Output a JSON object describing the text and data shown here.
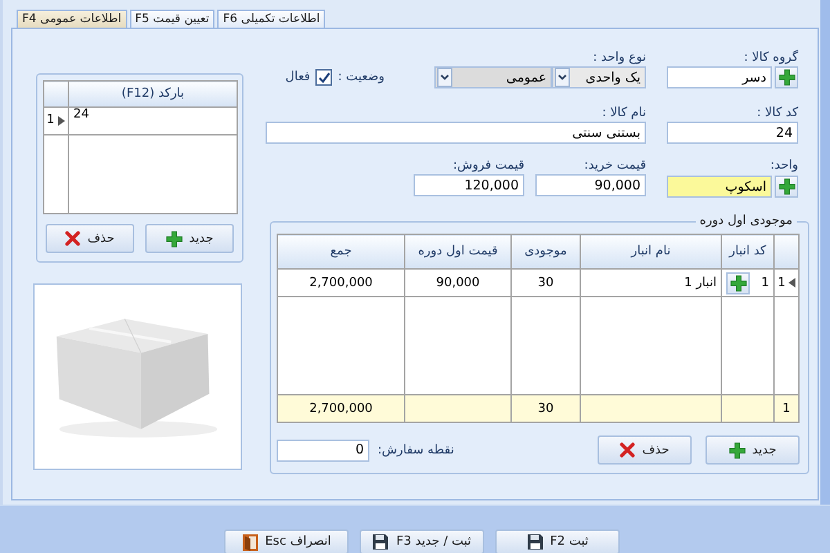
{
  "tabs": [
    {
      "label": "اطلاعات تکمیلی F6",
      "selected": false
    },
    {
      "label": "تعیین قیمت F5",
      "selected": false
    },
    {
      "label": "اطلاعات عمومی F4",
      "selected": true
    }
  ],
  "form": {
    "product_group": {
      "label": "گروه کالا :",
      "value": "دسر"
    },
    "unit_type": {
      "label": "نوع واحد :",
      "value": "یک واحدی"
    },
    "category": {
      "value": "عمومی"
    },
    "status": {
      "label": "وضعیت :",
      "option": "فعال",
      "checked": true
    },
    "product_code": {
      "label": "کد کالا :",
      "value": "24"
    },
    "product_name": {
      "label": "نام کالا :",
      "value": "بستنی سنتی"
    },
    "unit": {
      "label": "واحد:",
      "value": "اسکوپ"
    },
    "purchase_price": {
      "label": "قیمت خرید:",
      "value": "90,000"
    },
    "sale_price": {
      "label": "قیمت فروش:",
      "value": "120,000"
    }
  },
  "opening_stock": {
    "title": "موجودی اول دوره",
    "columns": [
      "کد انبار",
      "نام انبار",
      "موجودی",
      "قیمت اول دوره",
      "جمع"
    ],
    "rows": [
      {
        "index": "1",
        "current": true,
        "cells": [
          "1",
          "انبار 1",
          "30",
          "90,000",
          "2,700,000"
        ]
      }
    ],
    "footer": {
      "count": "1",
      "stock": "30",
      "total": "2,700,000"
    },
    "buttons": [
      {
        "kind": "new",
        "label": "جدید"
      },
      {
        "kind": "delete",
        "label": "حذف"
      }
    ],
    "reorder_point": {
      "label": "نقطه سفارش:",
      "value": "0"
    }
  },
  "barcodes": {
    "column": "بارکد (F12)",
    "rows": [
      {
        "index": "1",
        "current": true,
        "value": "24"
      }
    ],
    "buttons": [
      {
        "kind": "new",
        "label": "جدید"
      },
      {
        "kind": "delete",
        "label": "حذف"
      }
    ]
  },
  "actions": [
    {
      "kind": "save",
      "label": "ثبت F2"
    },
    {
      "kind": "save_new",
      "label": "ثبت / جدید F3"
    },
    {
      "kind": "cancel",
      "label": "انصراف Esc"
    }
  ]
}
